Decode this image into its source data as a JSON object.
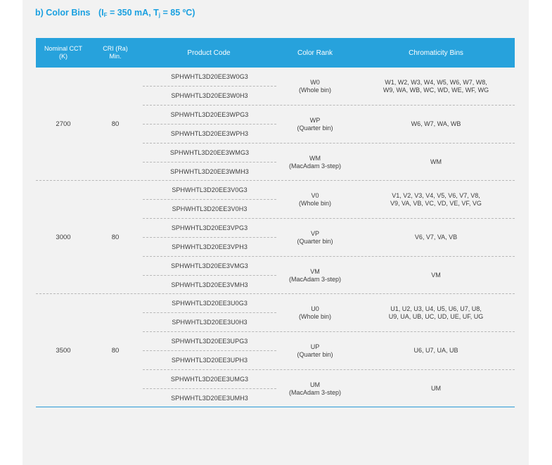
{
  "heading": {
    "label": "b)  Color Bins",
    "cond_prefix": "(I",
    "cond_sub_f": "F",
    "cond_mid": " = 350 mA, T",
    "cond_sub_j": "j",
    "cond_suffix": " = 85 ºC)"
  },
  "header": {
    "cct_line1": "Nominal CCT",
    "cct_line2": "(K)",
    "cri_line1": "CRI (Ra)",
    "cri_line2": "Min.",
    "code": "Product Code",
    "rank": "Color Rank",
    "bins": "Chromaticity Bins"
  },
  "groups": [
    {
      "cct": "2700",
      "cri": "80",
      "subs": [
        {
          "codes": [
            "SPHWHTL3D20EE3W0G3",
            "SPHWHTL3D20EE3W0H3"
          ],
          "rank": [
            "W0",
            "(Whole bin)"
          ],
          "bins": [
            "W1, W2, W3, W4, W5, W6, W7, W8,",
            "W9, WA, WB, WC, WD, WE, WF, WG"
          ]
        },
        {
          "codes": [
            "SPHWHTL3D20EE3WPG3",
            "SPHWHTL3D20EE3WPH3"
          ],
          "rank": [
            "WP",
            "(Quarter bin)"
          ],
          "bins": [
            "W6, W7, WA, WB",
            ""
          ]
        },
        {
          "codes": [
            "SPHWHTL3D20EE3WMG3",
            "SPHWHTL3D20EE3WMH3"
          ],
          "rank": [
            "WM",
            "(MacAdam 3-step)"
          ],
          "bins": [
            "WM",
            ""
          ]
        }
      ]
    },
    {
      "cct": "3000",
      "cri": "80",
      "subs": [
        {
          "codes": [
            "SPHWHTL3D20EE3V0G3",
            "SPHWHTL3D20EE3V0H3"
          ],
          "rank": [
            "V0",
            "(Whole bin)"
          ],
          "bins": [
            "V1, V2, V3, V4, V5, V6, V7, V8,",
            "V9, VA, VB, VC, VD, VE, VF, VG"
          ]
        },
        {
          "codes": [
            "SPHWHTL3D20EE3VPG3",
            "SPHWHTL3D20EE3VPH3"
          ],
          "rank": [
            "VP",
            "(Quarter bin)"
          ],
          "bins": [
            "V6, V7, VA, VB",
            ""
          ]
        },
        {
          "codes": [
            "SPHWHTL3D20EE3VMG3",
            "SPHWHTL3D20EE3VMH3"
          ],
          "rank": [
            "VM",
            "(MacAdam 3-step)"
          ],
          "bins": [
            "VM",
            ""
          ]
        }
      ]
    },
    {
      "cct": "3500",
      "cri": "80",
      "subs": [
        {
          "codes": [
            "SPHWHTL3D20EE3U0G3",
            "SPHWHTL3D20EE3U0H3"
          ],
          "rank": [
            "U0",
            "(Whole bin)"
          ],
          "bins": [
            "U1, U2, U3, U4, U5, U6, U7, U8,",
            "U9, UA, UB, UC, UD, UE, UF, UG"
          ]
        },
        {
          "codes": [
            "SPHWHTL3D20EE3UPG3",
            "SPHWHTL3D20EE3UPH3"
          ],
          "rank": [
            "UP",
            "(Quarter bin)"
          ],
          "bins": [
            "U6, U7, UA, UB",
            ""
          ]
        },
        {
          "codes": [
            "SPHWHTL3D20EE3UMG3",
            "SPHWHTL3D20EE3UMH3"
          ],
          "rank": [
            "UM",
            "(MacAdam 3-step)"
          ],
          "bins": [
            "UM",
            ""
          ]
        }
      ]
    }
  ],
  "colors": {
    "accent": "#27a2dc",
    "heading": "#1aa0e0",
    "page": "#f2f2f2"
  }
}
